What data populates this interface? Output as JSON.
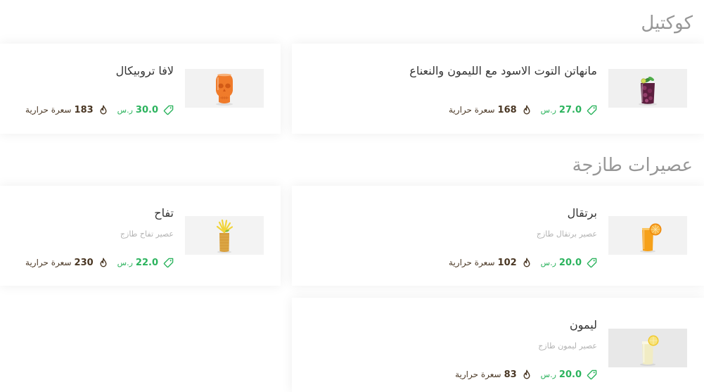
{
  "theme": {
    "title_color": "#333333",
    "section_title_color": "#979797",
    "price_color": "#2bb35d",
    "calories_color": "#4a3724",
    "description_color": "#b3b3b3",
    "card_background": "#ffffff"
  },
  "icons": {
    "price": "tag-icon",
    "calories": "fire-icon"
  },
  "sections": [
    {
      "title": "كوكتيل",
      "items": [
        {
          "name": "مانهاتن التوت الاسود مع الليمون والنعناع",
          "price": "27.0",
          "currency": "ر.س",
          "calories": "168",
          "calories_unit": "سعرة حرارية",
          "drink_color": "#5c1f3f"
        },
        {
          "name": "لافا تروبيكال",
          "price": "30.0",
          "currency": "ر.س",
          "calories": "183",
          "calories_unit": "سعرة حرارية",
          "drink_color": "#f07b2a"
        }
      ]
    },
    {
      "title": "عصيرات طازجة",
      "items": [
        {
          "name": "برتقال",
          "description": "عصير برتقال طازج",
          "price": "20.0",
          "currency": "ر.س",
          "calories": "102",
          "calories_unit": "سعرة حرارية",
          "drink_color": "#f6a11a"
        },
        {
          "name": "تفاح",
          "description": "عصير تفاح طازج",
          "price": "22.0",
          "currency": "ر.س",
          "calories": "230",
          "calories_unit": "سعرة حرارية",
          "drink_color": "#d79e3c"
        },
        {
          "name": "ليمون",
          "description": "عصير ليمون طازج",
          "price": "20.0",
          "currency": "ر.س",
          "calories": "83",
          "calories_unit": "سعرة حرارية",
          "drink_color": "#f1ecc4"
        }
      ]
    }
  ]
}
